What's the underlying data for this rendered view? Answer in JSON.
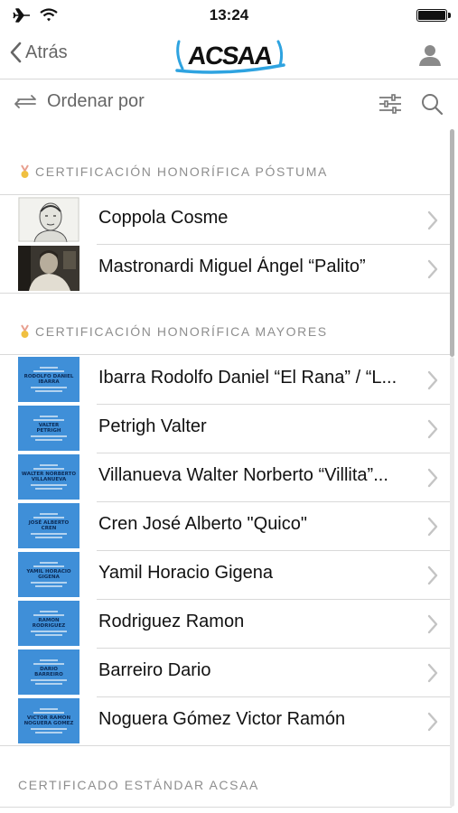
{
  "status": {
    "time": "13:24"
  },
  "nav": {
    "back_label": "Atrás",
    "logo_text": "ACSAA"
  },
  "toolbar": {
    "sort_label": "Ordenar por"
  },
  "sections": [
    {
      "title": "CERTIFICACIÓN HONORÍFICA PÓSTUMA",
      "items": [
        {
          "name": "Coppola Cosme",
          "thumb": "portrait-sketch"
        },
        {
          "name": "Mastronardi Miguel Ángel “Palito”",
          "thumb": "portrait-photo"
        }
      ]
    },
    {
      "title": "CERTIFICACIÓN HONORÍFICA MAYORES",
      "items": [
        {
          "name": "Ibarra Rodolfo Daniel “El Rana” / “L...",
          "thumb": "certificate"
        },
        {
          "name": "Petrigh Valter",
          "thumb": "certificate"
        },
        {
          "name": "Villanueva Walter Norberto “Villita”...",
          "thumb": "certificate"
        },
        {
          "name": "Cren José Alberto \"Quico\"",
          "thumb": "certificate"
        },
        {
          "name": "Yamil Horacio Gigena",
          "thumb": "certificate"
        },
        {
          "name": "Rodriguez Ramon",
          "thumb": "certificate"
        },
        {
          "name": "Barreiro Dario",
          "thumb": "certificate"
        },
        {
          "name": "Noguera Gómez Victor Ramón",
          "thumb": "certificate"
        }
      ]
    },
    {
      "title": "CERTIFICADO ESTÁNDAR ACSAA",
      "items": []
    }
  ],
  "colors": {
    "accent_blue": "#3f8fd8",
    "logo_cyan": "#2ea3e0",
    "text_gray": "#8e8e8e",
    "chevron": "#c4c4c4"
  },
  "icons": [
    "airplane-icon",
    "wifi-icon",
    "battery-icon",
    "chevron-left-icon",
    "user-icon",
    "sort-arrows-icon",
    "filter-sliders-icon",
    "search-icon",
    "medal-icon",
    "chevron-right-icon"
  ]
}
